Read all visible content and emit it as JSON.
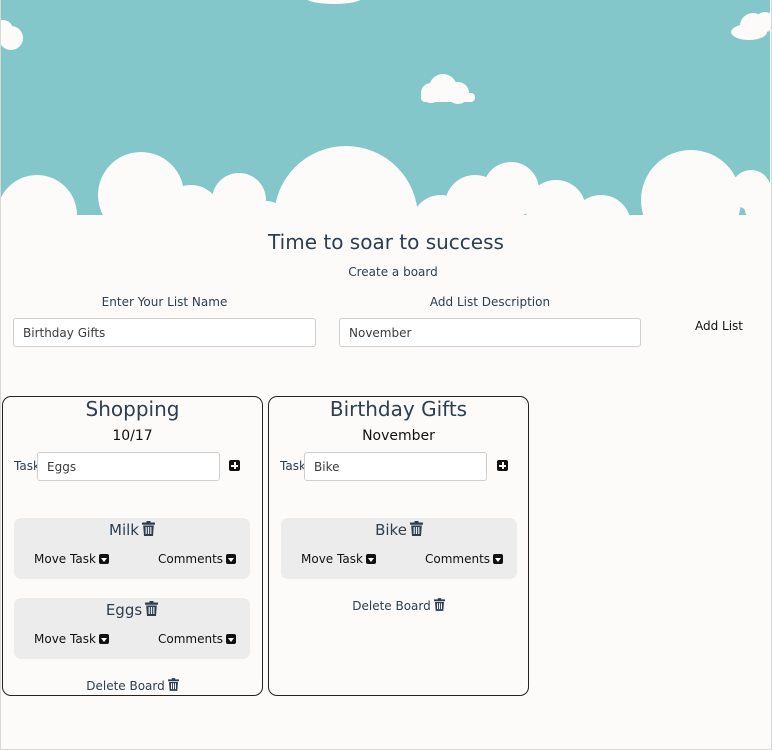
{
  "hero": {
    "title": "Time to soar to success",
    "subtitle": "Create a board"
  },
  "form": {
    "list_name_label": "Enter Your List Name",
    "list_name_value": "Birthday Gifts",
    "description_label": "Add List Description",
    "description_value": "November",
    "add_button": "Add List"
  },
  "boards": [
    {
      "title": "Shopping",
      "description": "10/17",
      "task_label": "Task",
      "task_input": "Eggs",
      "tasks": [
        {
          "name": "Milk",
          "move_label": "Move Task",
          "comments_label": "Comments"
        },
        {
          "name": "Eggs",
          "move_label": "Move Task",
          "comments_label": "Comments"
        }
      ],
      "delete_label": "Delete Board"
    },
    {
      "title": "Birthday Gifts",
      "description": "November",
      "task_label": "Task",
      "task_input": "Bike",
      "tasks": [
        {
          "name": "Bike",
          "move_label": "Move Task",
          "comments_label": "Comments"
        }
      ],
      "delete_label": "Delete Board"
    }
  ],
  "icons": {
    "add_task": "plus-square-icon",
    "delete_task": "trash-icon",
    "dropdown": "caret-down-icon"
  },
  "colors": {
    "sky": "#84c7cb",
    "cloud": "#fcfbf9",
    "card": "#ececec",
    "text": "#2c3e50"
  }
}
